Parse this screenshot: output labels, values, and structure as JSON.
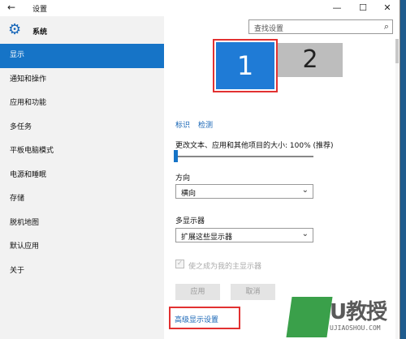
{
  "window": {
    "title": "设置",
    "back_glyph": "←",
    "minimize_glyph": "—",
    "maximize_glyph": "☐",
    "close_glyph": "✕"
  },
  "sidebar": {
    "section_title": "系统",
    "items": [
      {
        "label": "显示",
        "active": true
      },
      {
        "label": "通知和操作"
      },
      {
        "label": "应用和功能"
      },
      {
        "label": "多任务"
      },
      {
        "label": "平板电脑模式"
      },
      {
        "label": "电源和睡眠"
      },
      {
        "label": "存储"
      },
      {
        "label": "脱机地图"
      },
      {
        "label": "默认应用"
      },
      {
        "label": "关于"
      }
    ]
  },
  "search": {
    "placeholder": "查找设置"
  },
  "display": {
    "monitor1": "1",
    "monitor2": "2",
    "identify_link": "标识",
    "detect_link": "检测",
    "scale_label": "更改文本、应用和其他项目的大小: 100% (推荐)",
    "orientation_label": "方向",
    "orientation_value": "横向",
    "multi_display_label": "多显示器",
    "multi_display_value": "扩展这些显示器",
    "main_display_checkbox": "使之成为我的主显示器",
    "apply_button": "应用",
    "cancel_button": "取消",
    "advanced_link": "高级显示设置"
  },
  "watermark": {
    "text": "U教授",
    "domain": "UJIAOSHOU.COM"
  },
  "colors": {
    "accent": "#1674c7",
    "highlight": "#e23131"
  }
}
